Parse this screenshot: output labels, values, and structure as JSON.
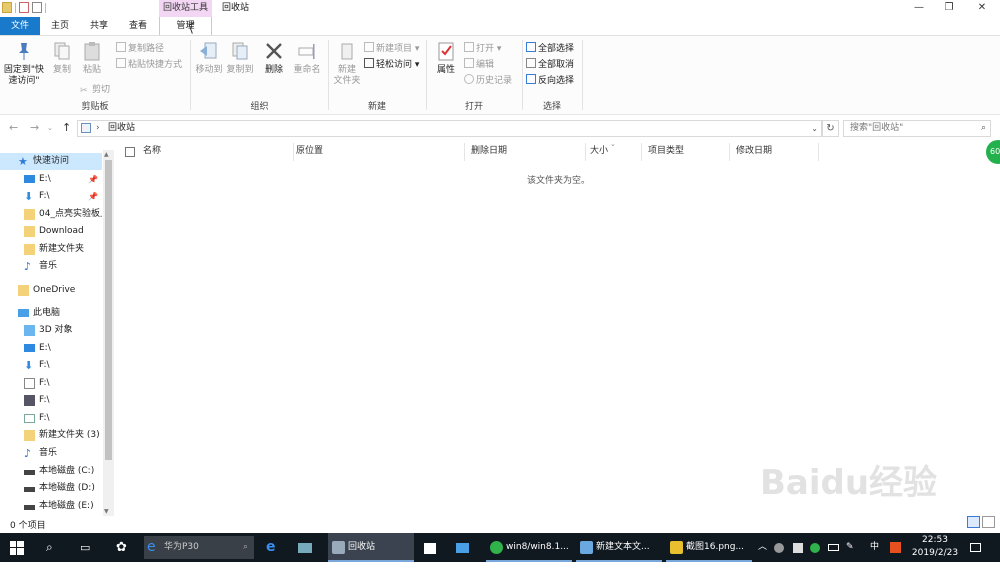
{
  "window": {
    "context_tab": "回收站工具",
    "title": "回收站",
    "minimize": "—",
    "maximize": "❐",
    "close": "✕"
  },
  "ribbon_tabs": {
    "file": "文件",
    "home": "主页",
    "share": "共享",
    "view": "查看",
    "manage": "管理"
  },
  "ribbon": {
    "clipboard": {
      "pin": "固定到\"快\n速访问\"",
      "copy": "复制",
      "paste": "粘贴",
      "copy_path": "复制路径",
      "paste_shortcut": "粘贴快捷方式",
      "cut": "剪切",
      "label": "剪贴板"
    },
    "organize": {
      "move_to": "移动到",
      "copy_to": "复制到",
      "delete": "删除",
      "rename": "重命名",
      "label": "组织"
    },
    "new": {
      "new_folder": "新建\n文件夹",
      "new_item": "新建项目",
      "easy_access": "轻松访问",
      "label": "新建"
    },
    "open": {
      "properties": "属性",
      "open": "打开",
      "edit": "编辑",
      "history": "历史记录",
      "label": "打开"
    },
    "select": {
      "select_all": "全部选择",
      "select_none": "全部取消",
      "invert": "反向选择",
      "label": "选择"
    }
  },
  "address": {
    "location": "回收站",
    "search_placeholder": "搜索\"回收站\""
  },
  "nav": {
    "quick_access": "快速访问",
    "items": [
      {
        "label": "E:\\",
        "pinned": true
      },
      {
        "label": "F:\\",
        "pinned": true
      },
      {
        "label": "04_点亮实验板上",
        "pinned": false
      },
      {
        "label": "Download",
        "pinned": false
      },
      {
        "label": "新建文件夹",
        "pinned": false
      },
      {
        "label": "音乐",
        "pinned": false
      }
    ],
    "onedrive": "OneDrive",
    "this_pc": "此电脑",
    "pc_items": [
      "3D 对象",
      "E:\\",
      "F:\\",
      "F:\\",
      "F:\\",
      "F:\\",
      "新建文件夹 (3) (",
      "音乐",
      "本地磁盘 (C:)",
      "本地磁盘 (D:)",
      "本地磁盘 (E:)"
    ]
  },
  "columns": [
    "名称",
    "原位置",
    "删除日期",
    "大小",
    "项目类型",
    "修改日期"
  ],
  "empty_message": "该文件夹为空。",
  "status_bar": "0 个项目",
  "badge": "60",
  "taskbar": {
    "search_text": "华为P30",
    "tasks": [
      {
        "label": "回收站"
      },
      {
        "label": "win8/win8.1..."
      },
      {
        "label": "新建文本文..."
      },
      {
        "label": "截图16.png..."
      }
    ],
    "ime": "中",
    "time": "22:53",
    "date": "2019/2/23"
  },
  "watermark": "Baidu经验"
}
